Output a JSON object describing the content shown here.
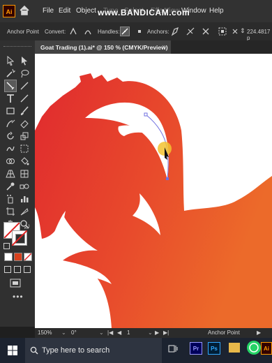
{
  "app": {
    "logo_text": "Ai",
    "watermark": "www.BANDICAM.com"
  },
  "menu": [
    "File",
    "Edit",
    "Object",
    "Type",
    "Select",
    "Effect",
    "View",
    "Window",
    "Help"
  ],
  "control_bar": {
    "tool_name": "Anchor Point",
    "convert_label": "Convert:",
    "handles_label": "Handles:",
    "anchors_label": "Anchors:",
    "coordinate": "224.4817 p"
  },
  "document": {
    "tab_title": "Goat Trading (1).ai* @ 150 % (CMYK/Preview)",
    "close_glyph": "×"
  },
  "status_bar": {
    "zoom": "150%",
    "rotation": "0°",
    "artboard": "1",
    "tool": "Anchor Point"
  },
  "taskbar": {
    "search_placeholder": "Type here to search",
    "apps": [
      "Pr",
      "Ps",
      "Ai"
    ]
  },
  "colors": {
    "accent_ai": "#ff9a00",
    "goat_red": "#e8312c",
    "goat_orange": "#ea5a2b",
    "selection": "#6f6fe0",
    "cursor_highlight": "#f2c230"
  }
}
